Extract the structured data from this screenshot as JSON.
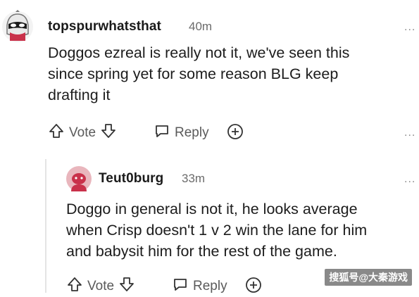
{
  "comment1": {
    "username": "topspurwhatsthat",
    "time": "40m",
    "text_lines": [
      "Doggos ezreal is really not it, we've seen this",
      "since spring yet for some reason BLG keep",
      "drafting it"
    ],
    "vote_label": "Vote",
    "reply_label": "Reply",
    "more": "..."
  },
  "comment2": {
    "username": "Teut0burg",
    "time": "33m",
    "text_lines": [
      "Doggo in general is not it, he looks average",
      "when Crisp doesn't 1 v 2 win the lane for him",
      "and babysit him for the rest of the game."
    ],
    "vote_label": "Vote",
    "reply_label": "Reply",
    "more": "..."
  },
  "watermark": "搜狐号@大秦游戏",
  "colors": {
    "avatar2_bg": "#e9b6bd",
    "avatar2_head": "#c9314a"
  }
}
